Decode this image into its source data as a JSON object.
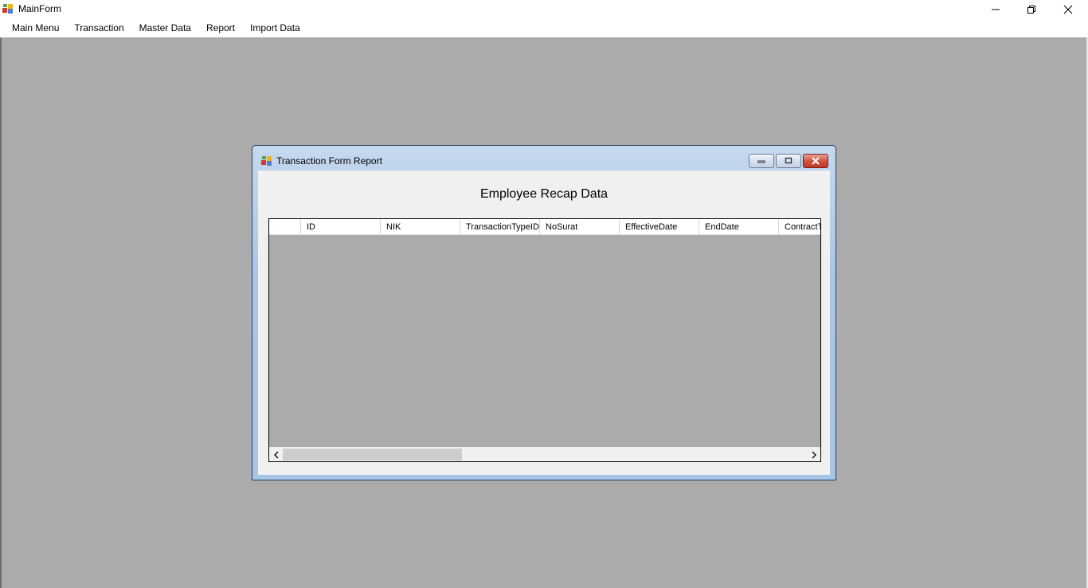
{
  "main_window": {
    "title": "MainForm"
  },
  "menu": {
    "items": [
      "Main Menu",
      "Transaction",
      "Master Data",
      "Report",
      "Import Data"
    ]
  },
  "child_window": {
    "title": "Transaction Form Report",
    "heading": "Employee Recap Data",
    "grid": {
      "columns": [
        "ID",
        "NIK",
        "TransactionTypeID",
        "NoSurat",
        "EffectiveDate",
        "EndDate",
        "ContractT"
      ],
      "rows": []
    },
    "horizontal_scroll": 0
  },
  "colors": {
    "mdi_background": "#ababab",
    "child_frame": "#a9c6e8",
    "close_button": "#c13a26"
  },
  "icons": [
    "app-icon",
    "minimize-icon",
    "maximize-icon",
    "close-icon",
    "scroll-left-icon",
    "scroll-right-icon"
  ]
}
